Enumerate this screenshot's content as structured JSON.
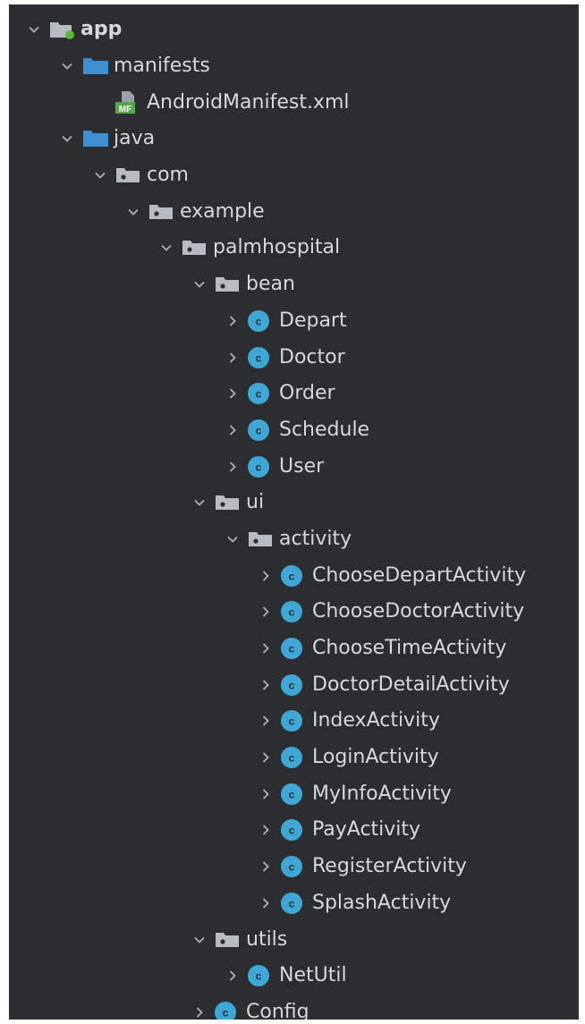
{
  "colors": {
    "panel_bg": "#2b2d30",
    "text": "#d6d8dc",
    "folder_blue": "#3d8fd1",
    "package_gray": "#b7bcc3",
    "class_circle": "#3fa7d6",
    "module_dot": "#5fb832",
    "manifest_green": "#55a84a"
  },
  "tree": [
    {
      "label": "app",
      "icon": "module-folder-icon",
      "expanded": true,
      "depth": 0,
      "bold": true
    },
    {
      "label": "manifests",
      "icon": "folder-icon",
      "expanded": true,
      "depth": 1
    },
    {
      "label": "AndroidManifest.xml",
      "icon": "manifest-file-icon",
      "expanded": null,
      "depth": 2
    },
    {
      "label": "java",
      "icon": "source-folder-icon",
      "expanded": true,
      "depth": 1
    },
    {
      "label": "com",
      "icon": "package-icon",
      "expanded": true,
      "depth": 2
    },
    {
      "label": "example",
      "icon": "package-icon",
      "expanded": true,
      "depth": 3
    },
    {
      "label": "palmhospital",
      "icon": "package-icon",
      "expanded": true,
      "depth": 4
    },
    {
      "label": "bean",
      "icon": "package-icon",
      "expanded": true,
      "depth": 5
    },
    {
      "label": "Depart",
      "icon": "class-icon",
      "expanded": false,
      "depth": 6
    },
    {
      "label": "Doctor",
      "icon": "class-icon",
      "expanded": false,
      "depth": 6
    },
    {
      "label": "Order",
      "icon": "class-icon",
      "expanded": false,
      "depth": 6
    },
    {
      "label": "Schedule",
      "icon": "class-icon",
      "expanded": false,
      "depth": 6
    },
    {
      "label": "User",
      "icon": "class-icon",
      "expanded": false,
      "depth": 6
    },
    {
      "label": "ui",
      "icon": "package-icon",
      "expanded": true,
      "depth": 5
    },
    {
      "label": "activity",
      "icon": "package-icon",
      "expanded": true,
      "depth": 6
    },
    {
      "label": "ChooseDepartActivity",
      "icon": "class-icon",
      "expanded": false,
      "depth": 7
    },
    {
      "label": "ChooseDoctorActivity",
      "icon": "class-icon",
      "expanded": false,
      "depth": 7
    },
    {
      "label": "ChooseTimeActivity",
      "icon": "class-icon",
      "expanded": false,
      "depth": 7
    },
    {
      "label": "DoctorDetailActivity",
      "icon": "class-icon",
      "expanded": false,
      "depth": 7
    },
    {
      "label": "IndexActivity",
      "icon": "class-icon",
      "expanded": false,
      "depth": 7
    },
    {
      "label": "LoginActivity",
      "icon": "class-icon",
      "expanded": false,
      "depth": 7
    },
    {
      "label": "MyInfoActivity",
      "icon": "class-icon",
      "expanded": false,
      "depth": 7
    },
    {
      "label": "PayActivity",
      "icon": "class-icon",
      "expanded": false,
      "depth": 7
    },
    {
      "label": "RegisterActivity",
      "icon": "class-icon",
      "expanded": false,
      "depth": 7
    },
    {
      "label": "SplashActivity",
      "icon": "class-icon",
      "expanded": false,
      "depth": 7
    },
    {
      "label": "utils",
      "icon": "package-icon",
      "expanded": true,
      "depth": 5
    },
    {
      "label": "NetUtil",
      "icon": "class-icon",
      "expanded": false,
      "depth": 6
    },
    {
      "label": "Config",
      "icon": "class-icon",
      "expanded": false,
      "depth": 5
    }
  ]
}
